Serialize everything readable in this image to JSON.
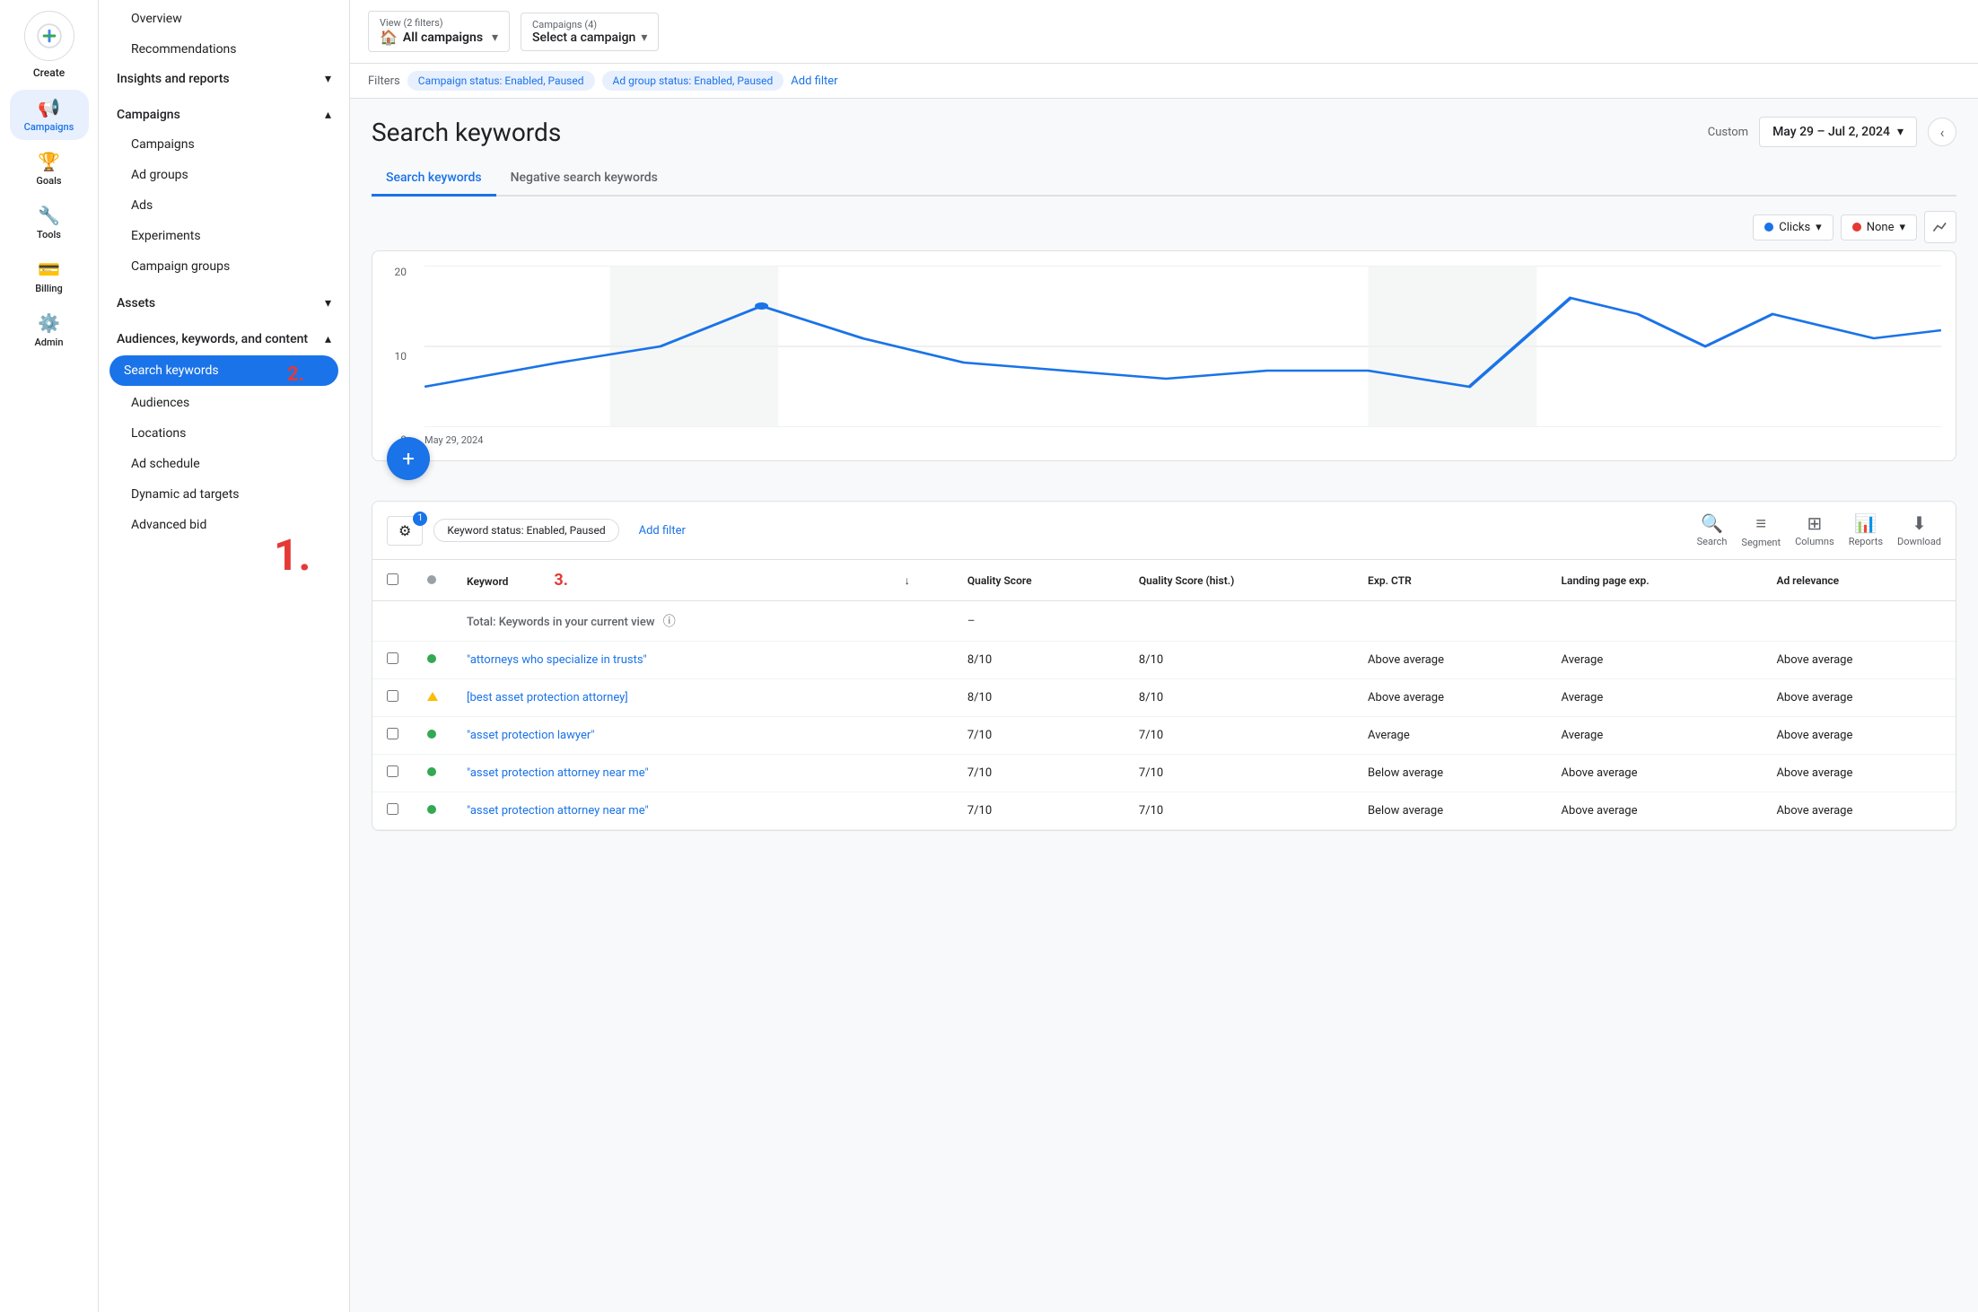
{
  "leftNav": {
    "createLabel": "Create",
    "items": [
      {
        "id": "campaigns",
        "label": "Campaigns",
        "icon": "📢",
        "active": true
      },
      {
        "id": "goals",
        "label": "Goals",
        "icon": "🏆",
        "active": false
      },
      {
        "id": "tools",
        "label": "Tools",
        "icon": "🔧",
        "active": false
      },
      {
        "id": "billing",
        "label": "Billing",
        "icon": "💳",
        "active": false
      },
      {
        "id": "admin",
        "label": "Admin",
        "icon": "⚙️",
        "active": false
      }
    ]
  },
  "sidebar": {
    "overview": "Overview",
    "recommendations": "Recommendations",
    "insightsReports": "Insights and reports",
    "campaigns": {
      "header": "Campaigns",
      "items": [
        "Campaigns",
        "Ad groups",
        "Ads",
        "Experiments",
        "Campaign groups"
      ]
    },
    "assets": {
      "header": "Assets"
    },
    "audiencesKeywords": {
      "header": "Audiences, keywords, and content",
      "items": [
        "Search keywords",
        "Audiences",
        "Locations",
        "Ad schedule",
        "Dynamic ad targets",
        "Advanced bid"
      ]
    }
  },
  "topbar": {
    "viewLabel": "View (2 filters)",
    "allCampaigns": "All campaigns",
    "campaignsCount": "Campaigns (4)",
    "selectCampaign": "Select a campaign"
  },
  "filterBar": {
    "filtersLabel": "Filters",
    "chip1": "Campaign status: Enabled, Paused",
    "chip2": "Ad group status: Enabled, Paused",
    "addFilter": "Add filter"
  },
  "pageHeader": {
    "title": "Search keywords",
    "customLabel": "Custom",
    "dateRange": "May 29 – Jul 2, 2024"
  },
  "tabs": {
    "tab1": "Search keywords",
    "tab2": "Negative search keywords"
  },
  "chart": {
    "clicksLabel": "Clicks",
    "noneLabel": "None",
    "chartTypeLabel": "Chart type",
    "yLabels": [
      "20",
      "10",
      "0"
    ],
    "xLabel": "May 29, 2024"
  },
  "tableToolbar": {
    "filterBadge": "1",
    "statusFilter": "Keyword status: Enabled, Paused",
    "addFilter": "Add filter",
    "search": "Search",
    "segment": "Segment",
    "columns": "Columns",
    "reports": "Reports",
    "download": "Download"
  },
  "table": {
    "headers": [
      "",
      "",
      "Keyword",
      "",
      "Quality Score",
      "Quality Score (hist.)",
      "Exp. CTR",
      "Landing page exp.",
      "Ad relevance"
    ],
    "totalRow": {
      "label": "Total: Keywords in your current view",
      "dash": "–"
    },
    "rows": [
      {
        "status": "green",
        "keyword": "\"attorneys who specialize in trusts\"",
        "qualityScore": "8/10",
        "qualityScoreHist": "8/10",
        "expCtr": "Above average",
        "landingPage": "Average",
        "adRelevance": "Above average"
      },
      {
        "status": "triangle",
        "keyword": "[best asset protection attorney]",
        "qualityScore": "8/10",
        "qualityScoreHist": "8/10",
        "expCtr": "Above average",
        "landingPage": "Average",
        "adRelevance": "Above average"
      },
      {
        "status": "green",
        "keyword": "\"asset protection lawyer\"",
        "qualityScore": "7/10",
        "qualityScoreHist": "7/10",
        "expCtr": "Average",
        "landingPage": "Average",
        "adRelevance": "Above average"
      },
      {
        "status": "green",
        "keyword": "\"asset protection attorney near me\"",
        "qualityScore": "7/10",
        "qualityScoreHist": "7/10",
        "expCtr": "Below average",
        "landingPage": "Above average",
        "adRelevance": "Above average"
      },
      {
        "status": "green",
        "keyword": "\"asset protection attorney near me\"",
        "qualityScore": "7/10",
        "qualityScoreHist": "7/10",
        "expCtr": "Below average",
        "landingPage": "Above average",
        "adRelevance": "Above average"
      }
    ]
  },
  "annotations": {
    "step1": "1.",
    "step2": "2.",
    "step3": "3."
  },
  "colors": {
    "primary": "#1a73e8",
    "active": "#e8f0fe",
    "border": "#e0e0e0"
  }
}
